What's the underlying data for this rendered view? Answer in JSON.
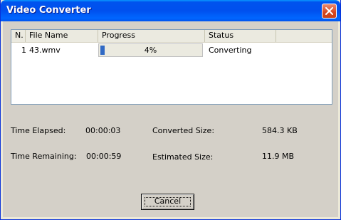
{
  "window": {
    "title": "Video Converter"
  },
  "list": {
    "columns": [
      "N.",
      "File Name",
      "Progress",
      "Status"
    ],
    "rows": [
      {
        "n": "1",
        "file_name": "43.wmv",
        "progress_text": "4%",
        "progress_fraction": 0.04,
        "status": "Converting"
      }
    ]
  },
  "info": {
    "time_elapsed_label": "Time Elapsed:",
    "time_elapsed_value": "00:00:03",
    "time_remaining_label": "Time Remaining:",
    "time_remaining_value": "00:00:59",
    "converted_size_label": "Converted Size:",
    "converted_size_value": "584.3 KB",
    "estimated_size_label": "Estimated Size:",
    "estimated_size_value": "11.9 MB"
  },
  "buttons": {
    "cancel_label": "Cancel"
  },
  "colors": {
    "titlebar": "#0053EE",
    "progress_fill": "#316AC5",
    "client_bg": "#D4D0C8"
  }
}
